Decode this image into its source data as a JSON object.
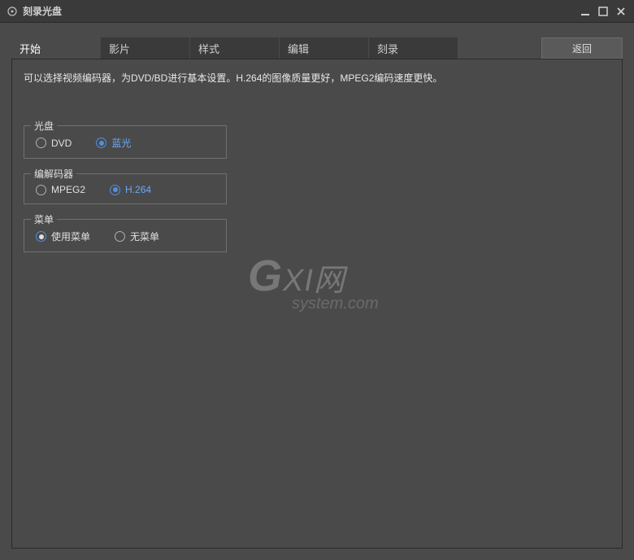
{
  "titlebar": {
    "title": "刻录光盘"
  },
  "tabs": {
    "start": "开始",
    "movie": "影片",
    "style": "样式",
    "edit": "编辑",
    "burn": "刻录"
  },
  "buttons": {
    "back": "返回"
  },
  "description": "可以选择视频编码器，为DVD/BD进行基本设置。H.264的图像质量更好，MPEG2编码速度更快。",
  "groups": {
    "disc": {
      "legend": "光盘",
      "options": {
        "dvd": "DVD",
        "bluray": "蓝光"
      }
    },
    "codec": {
      "legend": "编解码器",
      "options": {
        "mpeg2": "MPEG2",
        "h264": "H.264"
      }
    },
    "menu": {
      "legend": "菜单",
      "options": {
        "use_menu": "使用菜单",
        "no_menu": "无菜单"
      }
    }
  },
  "watermark": {
    "line1_big": "G",
    "line1_rest": "XI网",
    "line2": "system.com"
  }
}
